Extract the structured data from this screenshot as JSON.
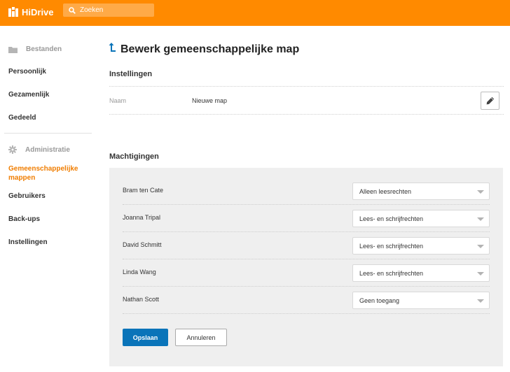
{
  "header": {
    "logo_text": "HiDrive",
    "search_placeholder": "Zoeken",
    "brand_color": "#ff8a00"
  },
  "sidebar": {
    "section_files": "Bestanden",
    "items_files": [
      {
        "label": "Persoonlijk"
      },
      {
        "label": "Gezamenlijk"
      },
      {
        "label": "Gedeeld"
      }
    ],
    "section_admin": "Administratie",
    "items_admin": [
      {
        "label": "Gemeenschappelijke mappen",
        "active": true
      },
      {
        "label": "Gebruikers"
      },
      {
        "label": "Back-ups"
      },
      {
        "label": "Instellingen"
      }
    ],
    "active_color": "#f07d00"
  },
  "main": {
    "title": "Bewerk gemeenschappelijke map",
    "settings": {
      "heading": "Instellingen",
      "name_label": "Naam",
      "name_value": "Nieuwe map"
    },
    "permissions": {
      "heading": "Machtigingen",
      "rows": [
        {
          "user": "Bram ten Cate",
          "access": "Alleen leesrechten"
        },
        {
          "user": "Joanna Tripal",
          "access": "Lees- en schrijfrechten"
        },
        {
          "user": "David Schmitt",
          "access": "Lees- en schrijfrechten"
        },
        {
          "user": "Linda Wang",
          "access": "Lees- en schrijfrechten"
        },
        {
          "user": "Nathan Scott",
          "access": "Geen toegang"
        }
      ]
    },
    "buttons": {
      "save": "Opslaan",
      "cancel": "Annuleren"
    },
    "primary_color": "#0a74b9"
  }
}
